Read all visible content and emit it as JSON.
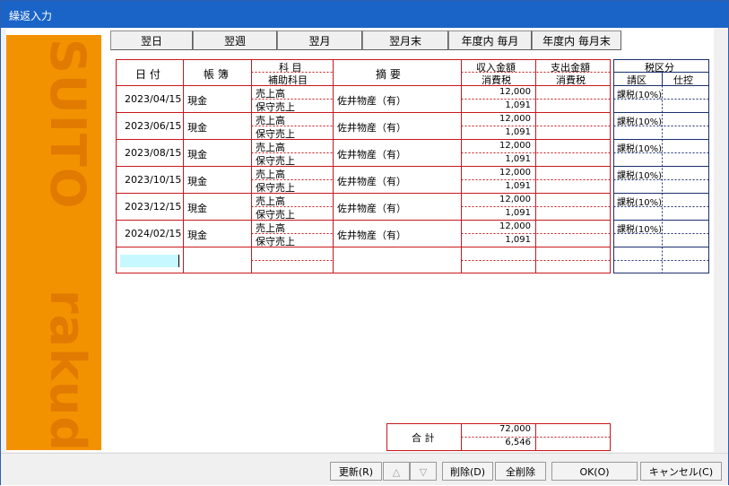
{
  "window": {
    "title": "繰返入力"
  },
  "sidebar": {
    "watermark_top": "SUITO",
    "watermark_bottom": "rakuda",
    "bg_color": "#f39200"
  },
  "period_tabs": [
    "翌日",
    "翌週",
    "翌月",
    "翌月末",
    "年度内 毎月",
    "年度内 毎月末"
  ],
  "table": {
    "headers": {
      "date": "日 付",
      "ledger": "帳 簿",
      "account": "科 目",
      "subaccount": "補助科目",
      "summary": "摘   要",
      "income": "収入金額",
      "income_tax": "消費税",
      "expense": "支出金額",
      "expense_tax": "消費税",
      "tax_category": "税区分",
      "tax_sales": "請区",
      "tax_purchase": "仕控"
    },
    "rows": [
      {
        "date": "2023/04/15",
        "ledger": "現金",
        "account": "売上高",
        "subaccount": "保守売上",
        "summary": "佐井物産（有）",
        "income": "12,000",
        "income_tax": "1,091",
        "expense": "",
        "expense_tax": "",
        "tax": "課税(10%)"
      },
      {
        "date": "2023/06/15",
        "ledger": "現金",
        "account": "売上高",
        "subaccount": "保守売上",
        "summary": "佐井物産（有）",
        "income": "12,000",
        "income_tax": "1,091",
        "expense": "",
        "expense_tax": "",
        "tax": "課税(10%)"
      },
      {
        "date": "2023/08/15",
        "ledger": "現金",
        "account": "売上高",
        "subaccount": "保守売上",
        "summary": "佐井物産（有）",
        "income": "12,000",
        "income_tax": "1,091",
        "expense": "",
        "expense_tax": "",
        "tax": "課税(10%)"
      },
      {
        "date": "2023/10/15",
        "ledger": "現金",
        "account": "売上高",
        "subaccount": "保守売上",
        "summary": "佐井物産（有）",
        "income": "12,000",
        "income_tax": "1,091",
        "expense": "",
        "expense_tax": "",
        "tax": "課税(10%)"
      },
      {
        "date": "2023/12/15",
        "ledger": "現金",
        "account": "売上高",
        "subaccount": "保守売上",
        "summary": "佐井物産（有）",
        "income": "12,000",
        "income_tax": "1,091",
        "expense": "",
        "expense_tax": "",
        "tax": "課税(10%)"
      },
      {
        "date": "2024/02/15",
        "ledger": "現金",
        "account": "売上高",
        "subaccount": "保守売上",
        "summary": "佐井物産（有）",
        "income": "12,000",
        "income_tax": "1,091",
        "expense": "",
        "expense_tax": "",
        "tax": "課税(10%)"
      }
    ]
  },
  "totals": {
    "label": "合 計",
    "income": "72,000",
    "income_tax": "6,546"
  },
  "buttons": {
    "update": "更新(R)",
    "up": "△",
    "down": "▽",
    "delete": "削除(D)",
    "delete_all": "全削除",
    "ok": "OK(O)",
    "cancel": "キャンセル(C)"
  },
  "colors": {
    "title_bar": "#1a64c8",
    "grid_red": "#c8181e",
    "grid_navy": "#1c2f6e",
    "input_highlight": "#c8f8ff"
  }
}
